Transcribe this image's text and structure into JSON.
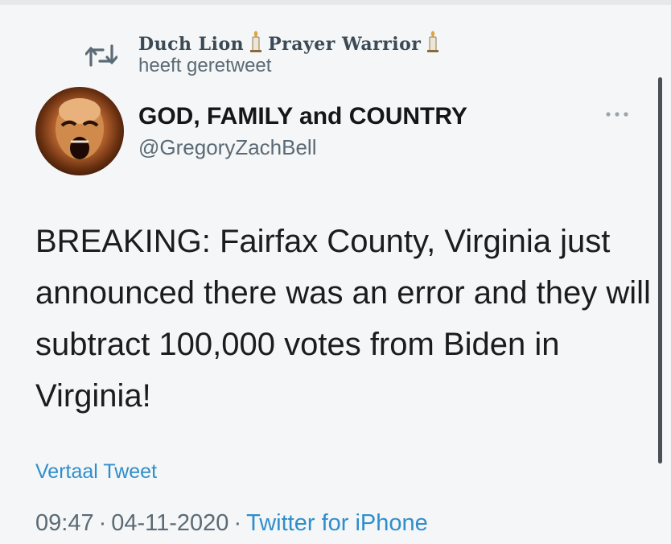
{
  "retweet": {
    "name_part1": "Duch Lion",
    "name_part2": "Prayer Warrior",
    "label": "heeft geretweet"
  },
  "author": {
    "display_name": "GOD, FAMILY and COUNTRY",
    "handle": "@GregoryZachBell"
  },
  "tweet": {
    "text": "BREAKING: Fairfax County, Virginia just announced there was an error and they will subtract 100,000 votes from Biden in Virginia!",
    "translate_label": "Vertaal Tweet",
    "time": "09:47",
    "separator": "·",
    "date": "04-11-2020",
    "source": "Twitter for iPhone"
  },
  "colors": {
    "link": "#2f8ecb",
    "secondary_text": "#5b6a75",
    "primary_text": "#161616"
  },
  "icons": {
    "retweet": "retweet-icon",
    "candle": "candle-icon",
    "more": "more-icon"
  }
}
